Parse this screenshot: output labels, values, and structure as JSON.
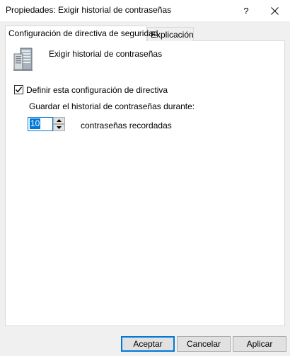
{
  "window": {
    "title": "Propiedades: Exigir historial de contraseñas",
    "help_label": "?",
    "close_icon": "close-icon"
  },
  "tabs": [
    {
      "label": "Configuración de directiva de seguridad",
      "active": true
    },
    {
      "label": "Explicación",
      "active": false
    }
  ],
  "policy": {
    "icon": "server-policy-icon",
    "name": "Exigir historial de contraseñas",
    "define_checkbox": {
      "label": "Definir esta configuración de directiva",
      "checked": true
    },
    "keep_label": "Guardar el historial de contraseñas durante:",
    "spin_value": "10",
    "unit_label": "contraseñas recordadas"
  },
  "buttons": {
    "ok": "Aceptar",
    "cancel": "Cancelar",
    "apply": "Aplicar"
  },
  "colors": {
    "accent": "#0078d7",
    "dialog_bg": "#f0f0f0",
    "panel_bg": "#ffffff"
  }
}
